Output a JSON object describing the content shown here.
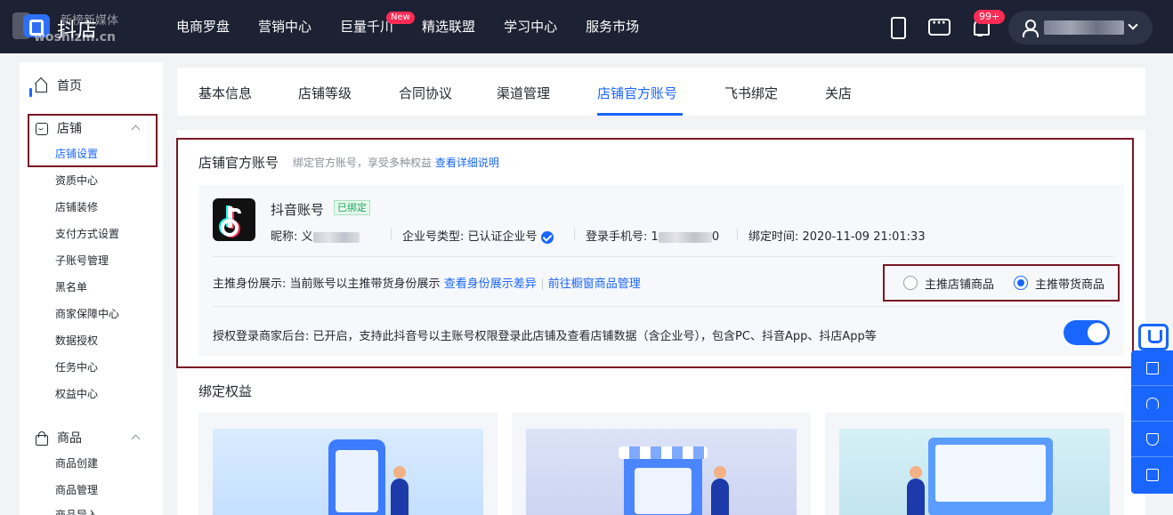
{
  "header": {
    "logo_text": "抖店",
    "watermark_top": "新榜新媒体",
    "watermark_bottom": "woshizm.cn",
    "nav": [
      {
        "label": "电商罗盘"
      },
      {
        "label": "营销中心"
      },
      {
        "label": "巨量千川",
        "badge": "New"
      },
      {
        "label": "精选联盟"
      },
      {
        "label": "学习中心"
      },
      {
        "label": "服务市场"
      }
    ],
    "notification_count": "99+"
  },
  "sidebar": {
    "home": "首页",
    "store_section": {
      "label": "店铺",
      "items": [
        "店铺设置",
        "资质中心",
        "店铺装修",
        "支付方式设置",
        "子账号管理",
        "黑名单",
        "商家保障中心",
        "数据授权",
        "任务中心",
        "权益中心"
      ]
    },
    "goods_section": {
      "label": "商品",
      "items": [
        "商品创建",
        "商品管理",
        "商品导入"
      ]
    }
  },
  "tabs": [
    "基本信息",
    "店铺等级",
    "合同协议",
    "渠道管理",
    "店铺官方账号",
    "飞书绑定",
    "关店"
  ],
  "active_tab_index": 4,
  "official_account": {
    "title": "店铺官方账号",
    "desc": "绑定官方账号，享受多种权益",
    "desc_link": "查看详细说明",
    "account_name": "抖音账号",
    "bound_badge": "已绑定",
    "nickname_label": "昵称:",
    "nickname_value_visible": "义",
    "type_label": "企业号类型:",
    "type_value": "已认证企业号",
    "phone_label": "登录手机号:",
    "phone_value_start": "1",
    "phone_value_end": "0",
    "bind_time_label": "绑定时间:",
    "bind_time_value": "2020-11-09 21:01:33",
    "identity_label": "主推身份展示:",
    "identity_text": "当前账号以主推带货身份展示",
    "identity_link1": "查看身份展示差异",
    "identity_link2": "前往橱窗商品管理",
    "radio_options": [
      "主推店铺商品",
      "主推带货商品"
    ],
    "radio_selected_index": 1,
    "auth_label": "授权登录商家后台:",
    "auth_text": "已开启，支持此抖音号以主账号权限登录此店铺及查看店铺数据（含企业号），包含PC、抖音App、抖店App等",
    "auth_enabled": true
  },
  "benefits": {
    "title": "绑定权益"
  },
  "colors": {
    "topbar": "#1c2133",
    "accent": "#1966ff",
    "highlight_border": "#7a1624",
    "badge_red": "#fe2c55"
  }
}
